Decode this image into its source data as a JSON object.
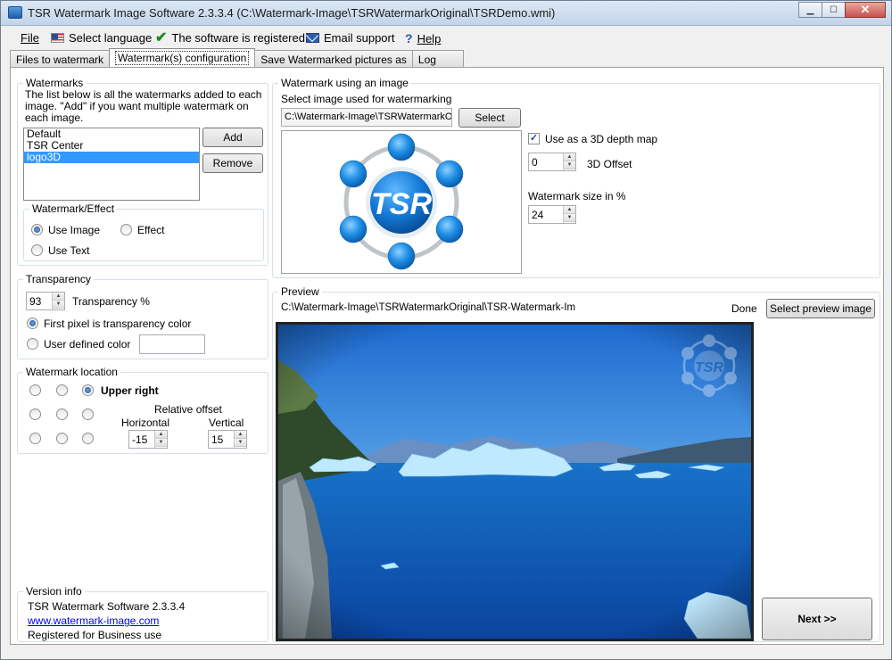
{
  "window": {
    "title": "TSR Watermark Image Software 2.3.3.4 (C:\\Watermark-Image\\TSRWatermarkOriginal\\TSRDemo.wmi)",
    "minimize": "▁",
    "maximize": "☐",
    "close": "✕"
  },
  "menu": {
    "file": "File",
    "language": "Select language",
    "registered": "The software is registered",
    "email": "Email support",
    "help": "Help"
  },
  "tabs": [
    "Files to watermark",
    "Watermark(s) configuration",
    "Save Watermarked pictures as",
    "Log"
  ],
  "watermarks": {
    "legend": "Watermarks",
    "description": "The list below is all the watermarks added to each image. \"Add\" if you want multiple watermark on each image.",
    "items": [
      "Default",
      "TSR Center",
      "logo3D"
    ],
    "selected_index": 2,
    "add_label": "Add",
    "remove_label": "Remove"
  },
  "effect": {
    "legend": "Watermark/Effect",
    "use_image": "Use Image",
    "effect": "Effect",
    "use_text": "Use Text"
  },
  "transparency": {
    "legend": "Transparency",
    "value": "93",
    "label": "Transparency %",
    "first_pixel": "First pixel is transparency color",
    "user_defined": "User defined color"
  },
  "location": {
    "legend": "Watermark location",
    "selected": "Upper right",
    "relative_offset": "Relative offset",
    "horizontal_label": "Horizontal",
    "vertical_label": "Vertical",
    "horizontal": "-15",
    "vertical": "15"
  },
  "version": {
    "legend": "Version info",
    "name": "TSR Watermark Software 2.3.3.4",
    "url": "www.watermark-image.com",
    "license": "Registered for Business use"
  },
  "image_wm": {
    "legend": "Watermark using an image",
    "select_label": "Select image used for watermarking",
    "path": "C:\\Watermark-Image\\TSRWatermarkO",
    "select_button": "Select",
    "depth_map": "Use as a 3D depth map",
    "offset_value": "0",
    "offset_label": "3D Offset",
    "size_label": "Watermark size in %",
    "size_value": "24",
    "logo_text": "TSR"
  },
  "preview": {
    "legend": "Preview",
    "path": "C:\\Watermark-Image\\TSRWatermarkOriginal\\TSR-Watermark-Im",
    "status": "Done",
    "select_button": "Select preview image",
    "watermark_text": "TSR"
  },
  "next_button": "Next >>",
  "colors": {
    "accent": "#3399ff",
    "logo_blue": "#1a7fd4"
  }
}
